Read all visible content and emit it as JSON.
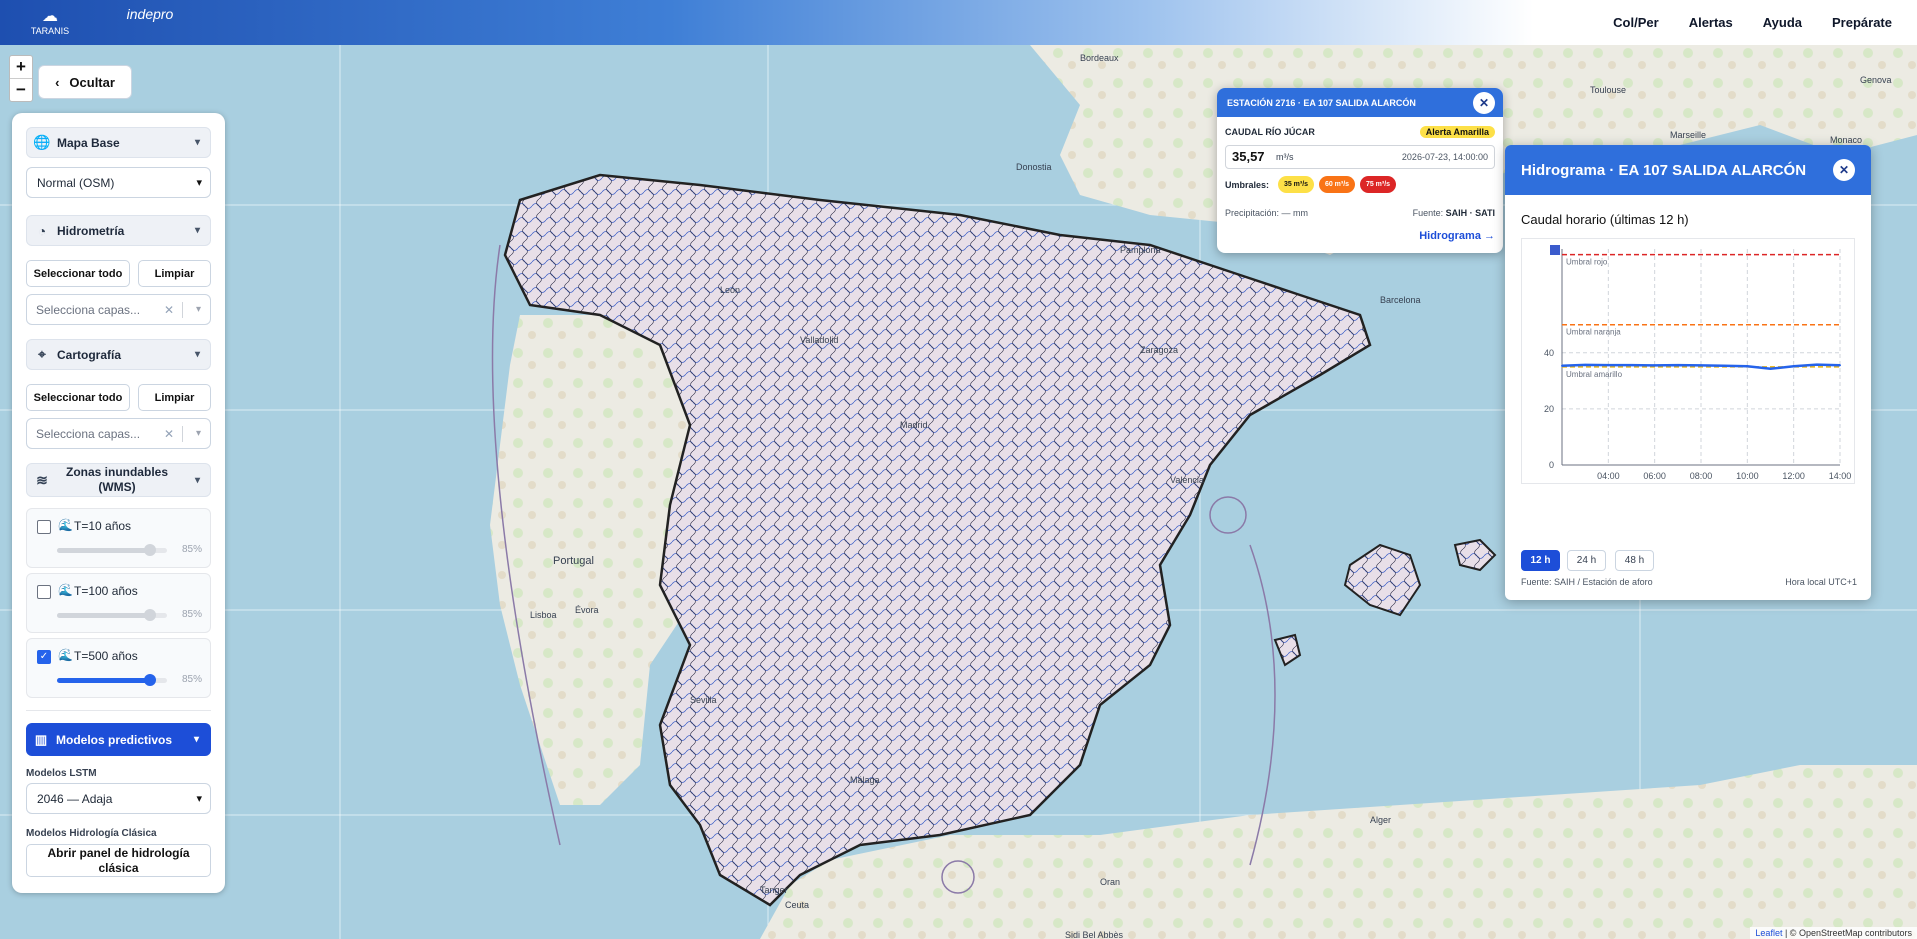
{
  "header": {
    "logos": [
      "TARANIS",
      "indepro"
    ],
    "nav": [
      "Col/Per",
      "Alertas",
      "Ayuda",
      "Prepárate"
    ]
  },
  "map_controls": {
    "zoom_in": "+",
    "zoom_out": "−",
    "hide_label": "Ocultar"
  },
  "sidebar": {
    "base_map": {
      "title": "Mapa Base",
      "selected": "Normal (OSM)"
    },
    "hydrometry": {
      "title": "Hidrometría",
      "select_all": "Seleccionar todo",
      "clear": "Limpiar",
      "placeholder": "Selecciona capas..."
    },
    "cartography": {
      "title": "Cartografía",
      "select_all": "Seleccionar todo",
      "clear": "Limpiar",
      "placeholder": "Selecciona capas..."
    },
    "flood_zones": {
      "title_line1": "Zonas inundables",
      "title_line2": "(WMS)",
      "items": [
        {
          "label": "T=10 años",
          "checked": false,
          "opacity": "85%"
        },
        {
          "label": "T=100 años",
          "checked": false,
          "opacity": "85%"
        },
        {
          "label": "T=500 años",
          "checked": true,
          "opacity": "85%"
        }
      ]
    },
    "predictive": {
      "title": "Modelos predictivos",
      "lstm_label": "Modelos LSTM",
      "lstm_selected": "2046 — Adaja",
      "classic_label": "Modelos Hidrología Clásica",
      "classic_button": "Abrir panel de hidrología clásica"
    }
  },
  "station_popup": {
    "title": "ESTACIÓN 2716 · EA 107 SALIDA ALARCÓN",
    "measure_label": "CAUDAL RÍO JÚCAR",
    "alert": "Alerta Amarilla",
    "value": "35,57",
    "unit": "m³/s",
    "timestamp": "2026-07-23, 14:00:00",
    "thresholds_label": "Umbrales:",
    "thresholds": [
      "35 m³/s",
      "60 m³/s",
      "75 m³/s"
    ],
    "precip": "Precipitación: — mm",
    "source_label": "Fuente:",
    "source": "SAIH · SATI",
    "link": "Hidrograma →"
  },
  "hydrograph": {
    "title": "Hidrograma · EA 107 SALIDA ALARCÓN",
    "subtitle": "Caudal horario (últimas 12 h)",
    "ranges": [
      "12 h",
      "24 h",
      "48 h"
    ],
    "footer_source": "Fuente: SAIH / Estación de aforo",
    "footer_time": "Hora local UTC+1"
  },
  "chart_data": {
    "type": "line",
    "x": [
      "02:00",
      "03:00",
      "04:00",
      "05:00",
      "06:00",
      "07:00",
      "08:00",
      "09:00",
      "10:00",
      "11:00",
      "12:00",
      "13:00",
      "14:00"
    ],
    "x_ticks": [
      "04:00",
      "06:00",
      "08:00",
      "10:00",
      "12:00",
      "14:00"
    ],
    "y_ticks": [
      0,
      20,
      40
    ],
    "ylim": [
      0,
      77
    ],
    "series": [
      {
        "values": [
          35.4,
          35.7,
          35.6,
          35.6,
          35.5,
          35.6,
          35.5,
          35.4,
          35.2,
          34.3,
          35.2,
          35.8,
          35.57
        ]
      }
    ],
    "thresholds": [
      {
        "label": "Umbral rojo",
        "value": 75,
        "color": "#dc2626"
      },
      {
        "label": "Umbral naranja",
        "value": 50,
        "color": "#f97316"
      },
      {
        "label": "Umbral amarillo",
        "value": 35,
        "color": "#eab308"
      }
    ],
    "grid": true,
    "line_color": "#2563eb"
  },
  "map_labels": [
    "Donostia",
    "Pamplona",
    "León",
    "Zaragoza",
    "Barcelona",
    "Valladolid",
    "Madrid",
    "Valencia",
    "Portugal",
    "Lisboa",
    "Évora",
    "Sevilla",
    "Málaga",
    "Alger",
    "Oran",
    "Tanger",
    "Bordeaux",
    "Toulouse",
    "Genova",
    "Monaco",
    "Marseille",
    "Sidi Bel Abbès",
    "Ceuta"
  ],
  "attribution": {
    "leaflet": "Leaflet",
    "rest": "| © OpenStreetMap contributors"
  }
}
